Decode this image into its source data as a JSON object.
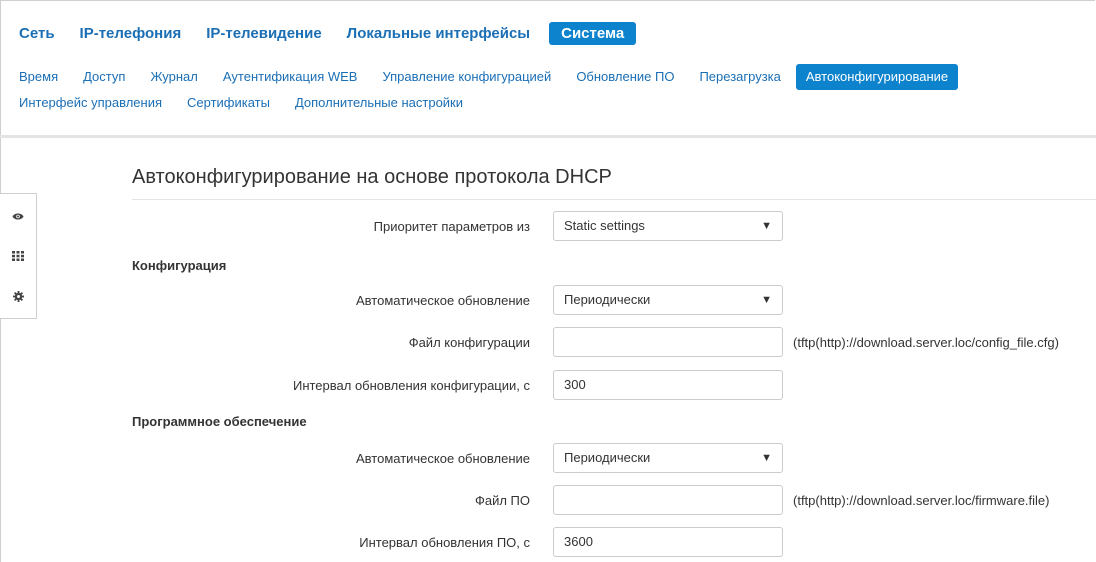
{
  "nav": {
    "primary": [
      {
        "label": "Сеть",
        "active": false
      },
      {
        "label": "IP-телефония",
        "active": false
      },
      {
        "label": "IP-телевидение",
        "active": false
      },
      {
        "label": "Локальные интерфейсы",
        "active": false
      },
      {
        "label": "Система",
        "active": true
      }
    ],
    "secondary_row1": [
      {
        "label": "Время",
        "active": false
      },
      {
        "label": "Доступ",
        "active": false
      },
      {
        "label": "Журнал",
        "active": false
      },
      {
        "label": "Аутентификация WEB",
        "active": false
      },
      {
        "label": "Управление конфигурацией",
        "active": false
      },
      {
        "label": "Обновление ПО",
        "active": false
      },
      {
        "label": "Перезагрузка",
        "active": false
      },
      {
        "label": "Автоконфигурирование",
        "active": true
      }
    ],
    "secondary_row2": [
      {
        "label": "Интерфейс управления",
        "active": false
      },
      {
        "label": "Сертификаты",
        "active": false
      },
      {
        "label": "Дополнительные настройки",
        "active": false
      }
    ]
  },
  "tools": [
    {
      "icon": "eye-icon"
    },
    {
      "icon": "grid-icon"
    },
    {
      "icon": "gear-icon"
    }
  ],
  "page": {
    "title": "Автоконфигурирование на основе протокола DHCP",
    "priority_label": "Приоритет параметров из",
    "priority_value": "Static settings",
    "config_section": "Конфигурация",
    "config_auto_update_label": "Автоматическое обновление",
    "config_auto_update_value": "Периодически",
    "config_file_label": "Файл конфигурации",
    "config_file_value": "",
    "config_file_hint": "(tftp(http)://download.server.loc/config_file.cfg)",
    "config_interval_label": "Интервал обновления конфигурации, с",
    "config_interval_value": "300",
    "fw_section": "Программное обеспечение",
    "fw_auto_update_label": "Автоматическое обновление",
    "fw_auto_update_value": "Периодически",
    "fw_file_label": "Файл ПО",
    "fw_file_value": "",
    "fw_file_hint": "(tftp(http)://download.server.loc/firmware.file)",
    "fw_interval_label": "Интервал обновления ПО, с",
    "fw_interval_value": "3600"
  },
  "colors": {
    "accent": "#0e83cd",
    "link": "#1b6fb5"
  }
}
